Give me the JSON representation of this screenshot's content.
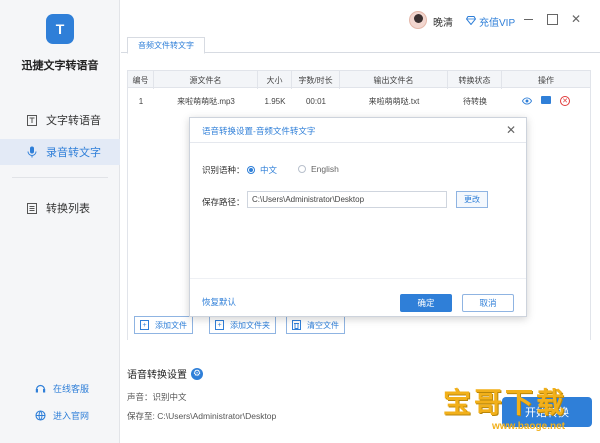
{
  "sidebar": {
    "logo_letter": "T",
    "app_title": "迅捷文字转语音",
    "items": [
      {
        "label": "文字转语音",
        "icon": "text-icon",
        "active": false
      },
      {
        "label": "录音转文字",
        "icon": "microphone-icon",
        "active": true
      },
      {
        "label": "转换列表",
        "icon": "list-icon",
        "active": false
      }
    ],
    "footer": [
      {
        "label": "在线客服",
        "icon": "headset-icon"
      },
      {
        "label": "进入官网",
        "icon": "globe-icon"
      }
    ]
  },
  "titlebar": {
    "username": "晚清",
    "vip_label": "充值VIP",
    "close_glyph": "✕"
  },
  "tab": {
    "label": "音频文件转文字"
  },
  "table": {
    "columns": [
      "编号",
      "源文件名",
      "大小",
      "字数/时长",
      "输出文件名",
      "转换状态",
      "操作"
    ],
    "rows": [
      {
        "id": "1",
        "source": "来啦萌萌哒.mp3",
        "size": "1.95K",
        "duration": "00:01",
        "output": "来啦萌萌哒.txt",
        "status": "待转换"
      }
    ]
  },
  "buttons": {
    "add_file": "添加文件",
    "add_folder": "添加文件夹",
    "clear_files": "清空文件"
  },
  "settings": {
    "title": "语音转换设置",
    "voice_line": "声音：识别中文",
    "save_line": "保存至: C:\\Users\\Administrator\\Desktop"
  },
  "start_button": {
    "label": "开始转换"
  },
  "watermark": {
    "text": "宝哥下载",
    "url": "www.baoge.net"
  },
  "dialog": {
    "title": "语音转换设置-音频文件转文字",
    "lang_label": "识别语种：",
    "options": [
      "中文",
      "English"
    ],
    "selected_option": "中文",
    "path_label": "保存路径：",
    "path_value": "C:\\Users\\Administrator\\Desktop",
    "change_label": "更改",
    "restore_label": "恢复默认",
    "ok_label": "确定",
    "cancel_label": "取消"
  },
  "colors": {
    "accent": "#2f7fd8",
    "danger": "#e03a3a",
    "watermark": "#f2b01a"
  }
}
